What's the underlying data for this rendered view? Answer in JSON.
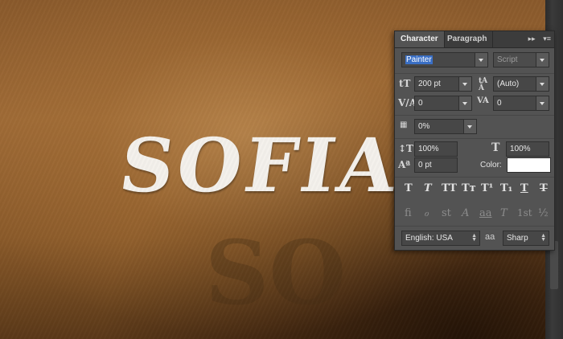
{
  "canvas": {
    "main_text": "SOFIA",
    "shadow_text": "SO"
  },
  "panel": {
    "tabs": [
      {
        "label": "Character",
        "active": true
      },
      {
        "label": "Paragraph",
        "active": false
      }
    ],
    "font_family": "Painter",
    "font_style": "Script",
    "font_size": "200 pt",
    "leading": "(Auto)",
    "kerning": "0",
    "tracking": "0",
    "tsume": "0%",
    "vertical_scale": "100%",
    "horizontal_scale": "100%",
    "baseline_shift": "0 pt",
    "color_label": "Color:",
    "text_color": "#ffffff",
    "type_styles": [
      "T",
      "T",
      "TT",
      "Tт",
      "T¹",
      "T₁",
      "T",
      "T"
    ],
    "opentype": [
      "ﬁ",
      "ℴ",
      "st",
      "A",
      "aa",
      "T",
      "1st",
      "½"
    ],
    "language": "English: USA",
    "aa_label": "aa",
    "antialias": "Sharp"
  }
}
